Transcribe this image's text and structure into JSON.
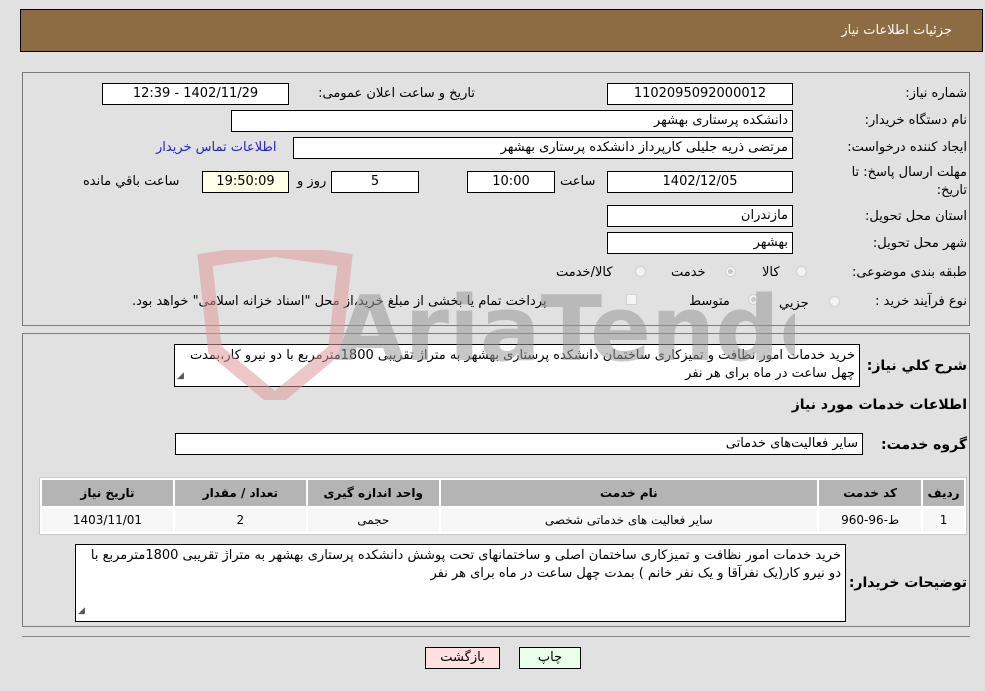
{
  "header": {
    "title": "جزئيات اطلاعات نیاز"
  },
  "form": {
    "need_number": {
      "label": "شماره نیاز:",
      "value": "1102095092000012"
    },
    "announce_datetime": {
      "label": "تاریخ و ساعت اعلان عمومی:",
      "value": "1402/11/29 - 12:39"
    },
    "buyer_org": {
      "label": "نام دستگاه خریدار:",
      "value": "دانشکده پرستاری بهشهر"
    },
    "requester": {
      "label": "ایجاد کننده درخواست:",
      "value": "مرتضی ذریه جلیلی کارپرداز دانشکده پرستاری بهشهر"
    },
    "buyer_contact_link": "اطلاعات تماس خریدار",
    "deadline": {
      "label_line1": "مهلت ارسال پاسخ: تا",
      "label_line2": "تاریخ:",
      "date": "1402/12/05",
      "time_label": "ساعت",
      "time": "10:00",
      "days": "5",
      "days_label": "روز و",
      "remaining": "19:50:09",
      "remaining_label": "ساعت باقي مانده"
    },
    "province": {
      "label": "استان محل تحویل:",
      "value": "مازندران"
    },
    "city": {
      "label": "شهر محل تحویل:",
      "value": "بهشهر"
    },
    "category": {
      "label": "طبقه بندی موضوعی:",
      "options": [
        "کالا",
        "خدمت",
        "کالا/خدمت"
      ],
      "selected": "خدمت"
    },
    "process_type": {
      "label": "نوع فرآیند خرید :",
      "options": [
        "جزیي",
        "متوسط"
      ],
      "selected": "متوسط",
      "treasury_note": "پرداخت تمام یا بخشی از مبلغ خرید،از محل \"اسناد خزانه اسلامی\" خواهد بود."
    }
  },
  "summary": {
    "label": "شرح کلي نیاز:",
    "value": "خرید خدمات امور نظافت و تمیزکاری ساختمان دانشکده پرستاری بهشهر به متراژ تقریبی 1800مترمربع  با دو نیرو کار،بمدت چهل ساعت در ماه برای هر نفر"
  },
  "services_section": {
    "title": "اطلاعات خدمات مورد نیاز",
    "group_label": "گروه خدمت:",
    "group_value": "سایر فعالیت‌های خدماتی",
    "table": {
      "headers": [
        "ردیف",
        "کد خدمت",
        "نام خدمت",
        "واحد اندازه گیری",
        "تعداد / مقدار",
        "تاریخ نیاز"
      ],
      "rows": [
        [
          "1",
          "ط-96-960",
          "سایر فعالیت های خدماتی شخصی",
          "حجمی",
          "2",
          "1403/11/01"
        ]
      ]
    }
  },
  "buyer_notes": {
    "label": "توضیحات خریدار:",
    "value": "خرید خدمات امور نظافت و تمیزکاری ساختمان اصلی و ساختمانهای تحت پوشش دانشکده پرستاری بهشهر به متراژ تقریبی 1800مترمربع  با دو نیرو کار(یک نفرآقا و یک نفر خانم ) بمدت چهل ساعت در ماه برای هر نفر"
  },
  "buttons": {
    "print": "چاپ",
    "back": "بازگشت"
  },
  "colors": {
    "header_bg": "#8d6c44",
    "print_bg": "#e9ffe9",
    "back_bg": "#ffe0e0",
    "link": "#2222cc"
  },
  "watermark": {
    "text": "AriaTender.neT"
  }
}
